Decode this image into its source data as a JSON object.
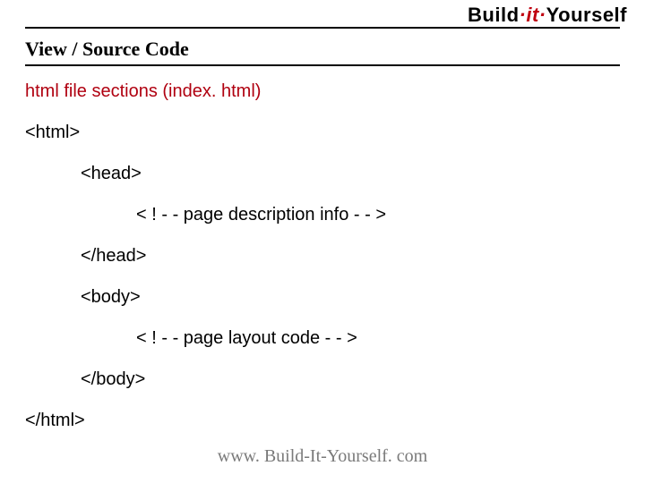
{
  "logo": {
    "part1": "Build",
    "part2": "·it·",
    "part3": "Yourself"
  },
  "section_title": "View / Source Code",
  "subtitle": "html file sections (index. html)",
  "code": {
    "html_open": "<html>",
    "head_open": "<head>",
    "comment1": "< ! - - page description info - - >",
    "head_close": "</head>",
    "body_open": "<body>",
    "comment2": "< ! - - page layout code - - >",
    "body_close": "</body>",
    "html_close": "</html>"
  },
  "footer": "www. Build-It-Yourself. com"
}
